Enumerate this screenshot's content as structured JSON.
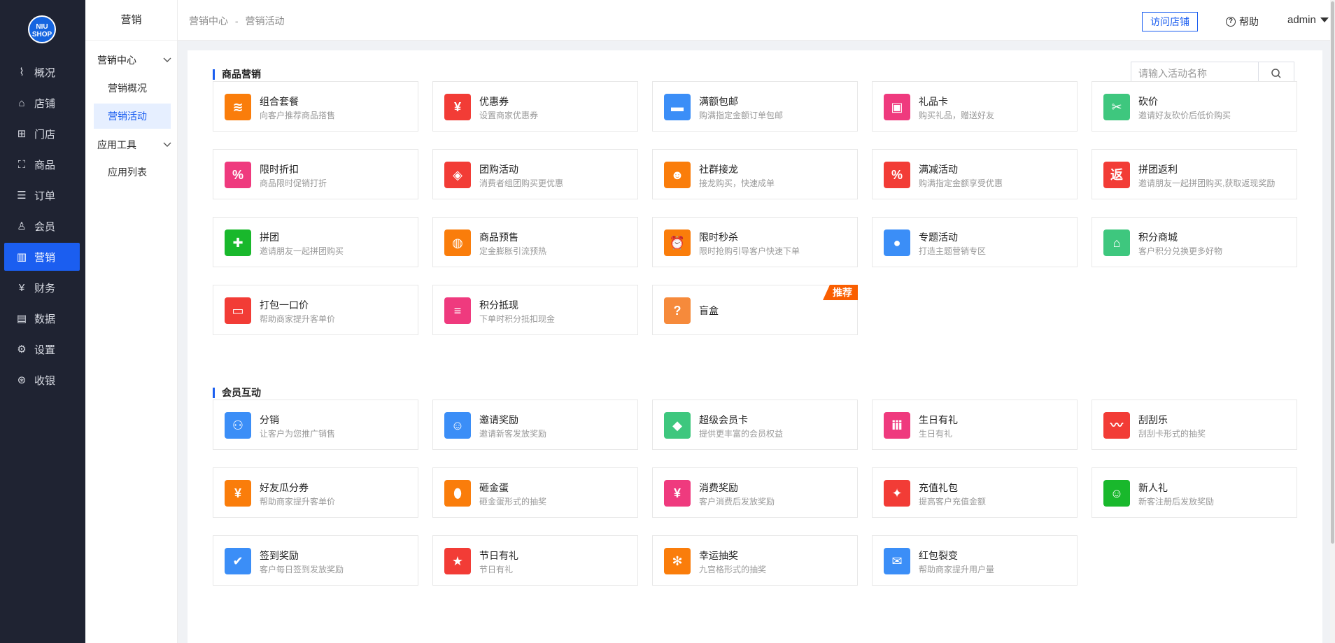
{
  "logo": {
    "line1": "NIU",
    "line2": "SHOP"
  },
  "nav": [
    {
      "label": "概况",
      "icon": "chart-line-icon"
    },
    {
      "label": "店铺",
      "icon": "store-icon"
    },
    {
      "label": "门店",
      "icon": "shop-front-icon"
    },
    {
      "label": "商品",
      "icon": "bag-icon"
    },
    {
      "label": "订单",
      "icon": "order-list-icon"
    },
    {
      "label": "会员",
      "icon": "user-icon"
    },
    {
      "label": "营销",
      "icon": "bar-chart-icon",
      "active": true
    },
    {
      "label": "财务",
      "icon": "yen-icon"
    },
    {
      "label": "数据",
      "icon": "data-chart-icon"
    },
    {
      "label": "设置",
      "icon": "gear-icon"
    },
    {
      "label": "收银",
      "icon": "cash-register-icon"
    }
  ],
  "sidebar": {
    "title": "营销",
    "group1": "营销中心",
    "link1": "营销概况",
    "link2": "营销活动",
    "group2": "应用工具",
    "link3": "应用列表"
  },
  "header": {
    "crumb1": "营销中心",
    "sep": "-",
    "crumb2": "营销活动",
    "visit": "访问店铺",
    "help": "帮助",
    "user": "admin"
  },
  "search": {
    "placeholder": "请输入活动名称"
  },
  "sections": [
    {
      "title": "商品营销",
      "cards": [
        {
          "title": "组合套餐",
          "desc": "向客户推荐商品搭售",
          "color": "#fa7d0b",
          "icon": "layers-icon",
          "glyph": "≋"
        },
        {
          "title": "优惠券",
          "desc": "设置商家优惠券",
          "color": "#f23c36",
          "icon": "coupon-icon",
          "glyph": "¥"
        },
        {
          "title": "满额包邮",
          "desc": "购满指定金额订单包邮",
          "color": "#3b8ef7",
          "icon": "truck-icon",
          "glyph": "▬"
        },
        {
          "title": "礼品卡",
          "desc": "购买礼品，赠送好友",
          "color": "#ef3a7e",
          "icon": "gift-card-icon",
          "glyph": "▣"
        },
        {
          "title": "砍价",
          "desc": "邀请好友砍价后低价购买",
          "color": "#3ec77e",
          "icon": "tag-cut-icon",
          "glyph": "✂"
        },
        {
          "title": "限时折扣",
          "desc": "商品限时促销打折",
          "color": "#ef3a7e",
          "icon": "discount-icon",
          "glyph": "%"
        },
        {
          "title": "团购活动",
          "desc": "消费者组团购买更优惠",
          "color": "#f23c36",
          "icon": "tag-icon",
          "glyph": "◈"
        },
        {
          "title": "社群接龙",
          "desc": "接龙购买，快速成单",
          "color": "#fa7d0b",
          "icon": "group-icon",
          "glyph": "☻"
        },
        {
          "title": "满减活动",
          "desc": "购满指定金额享受优惠",
          "color": "#f23c36",
          "icon": "percent-ticket-icon",
          "glyph": "%"
        },
        {
          "title": "拼团返利",
          "desc": "邀请朋友一起拼团购买,获取返现奖励",
          "color": "#f23c36",
          "icon": "rebate-icon",
          "glyph": "返"
        },
        {
          "title": "拼团",
          "desc": "邀请朋友一起拼团购买",
          "color": "#19b82c",
          "icon": "puzzle-icon",
          "glyph": "✚"
        },
        {
          "title": "商品预售",
          "desc": "定金膨胀引流预热",
          "color": "#fa7d0b",
          "icon": "presale-bag-icon",
          "glyph": "◍"
        },
        {
          "title": "限时秒杀",
          "desc": "限时抢购引导客户快速下单",
          "color": "#fa7d0b",
          "icon": "alarm-clock-icon",
          "glyph": "⏰"
        },
        {
          "title": "专题活动",
          "desc": "打造主题营销专区",
          "color": "#3b8ef7",
          "icon": "bulb-icon",
          "glyph": "●"
        },
        {
          "title": "积分商城",
          "desc": "客户积分兑换更多好物",
          "color": "#3ec77e",
          "icon": "points-store-icon",
          "glyph": "⌂"
        },
        {
          "title": "打包一口价",
          "desc": "帮助商家提升客单价",
          "color": "#f23c36",
          "icon": "box-icon",
          "glyph": "▭"
        },
        {
          "title": "积分抵现",
          "desc": "下单时积分抵扣现金",
          "color": "#ef3a7e",
          "icon": "coins-icon",
          "glyph": "≡"
        },
        {
          "title": "盲盒",
          "desc": "",
          "color": "#f68a3b",
          "icon": "blind-box-icon",
          "glyph": "?",
          "badge": "推荐"
        }
      ]
    },
    {
      "title": "会员互动",
      "cards": [
        {
          "title": "分销",
          "desc": "让客户为您推广销售",
          "color": "#3b8ef7",
          "icon": "network-icon",
          "glyph": "⚇"
        },
        {
          "title": "邀请奖励",
          "desc": "邀请新客发放奖励",
          "color": "#3b8ef7",
          "icon": "invite-icon",
          "glyph": "☺"
        },
        {
          "title": "超级会员卡",
          "desc": "提供更丰富的会员权益",
          "color": "#3ec77e",
          "icon": "diamond-icon",
          "glyph": "◆"
        },
        {
          "title": "生日有礼",
          "desc": "生日有礼",
          "color": "#ef3a7e",
          "icon": "cake-icon",
          "glyph": "ⅲ"
        },
        {
          "title": "刮刮乐",
          "desc": "刮刮卡形式的抽奖",
          "color": "#f23c36",
          "icon": "scratch-card-icon",
          "glyph": "〰"
        },
        {
          "title": "好友瓜分券",
          "desc": "帮助商家提升客单价",
          "color": "#fa7d0b",
          "icon": "split-coupon-icon",
          "glyph": "¥"
        },
        {
          "title": "砸金蛋",
          "desc": "砸金蛋形式的抽奖",
          "color": "#fa7d0b",
          "icon": "egg-icon",
          "glyph": "⬮"
        },
        {
          "title": "消费奖励",
          "desc": "客户消费后发放奖励",
          "color": "#ef3a7e",
          "icon": "money-bag-icon",
          "glyph": "¥"
        },
        {
          "title": "充值礼包",
          "desc": "提高客户充值金额",
          "color": "#f23c36",
          "icon": "gift-icon",
          "glyph": "✦"
        },
        {
          "title": "新人礼",
          "desc": "新客注册后发放奖励",
          "color": "#19b82c",
          "icon": "new-user-icon",
          "glyph": "☺"
        },
        {
          "title": "签到奖励",
          "desc": "客户每日签到发放奖励",
          "color": "#3b8ef7",
          "icon": "calendar-check-icon",
          "glyph": "✔"
        },
        {
          "title": "节日有礼",
          "desc": "节日有礼",
          "color": "#f23c36",
          "icon": "star-icon",
          "glyph": "★"
        },
        {
          "title": "幸运抽奖",
          "desc": "九宫格形式的抽奖",
          "color": "#fa7d0b",
          "icon": "wheel-icon",
          "glyph": "✻"
        },
        {
          "title": "红包裂变",
          "desc": "帮助商家提升用户量",
          "color": "#3b8ef7",
          "icon": "red-packet-icon",
          "glyph": "✉"
        }
      ]
    }
  ]
}
